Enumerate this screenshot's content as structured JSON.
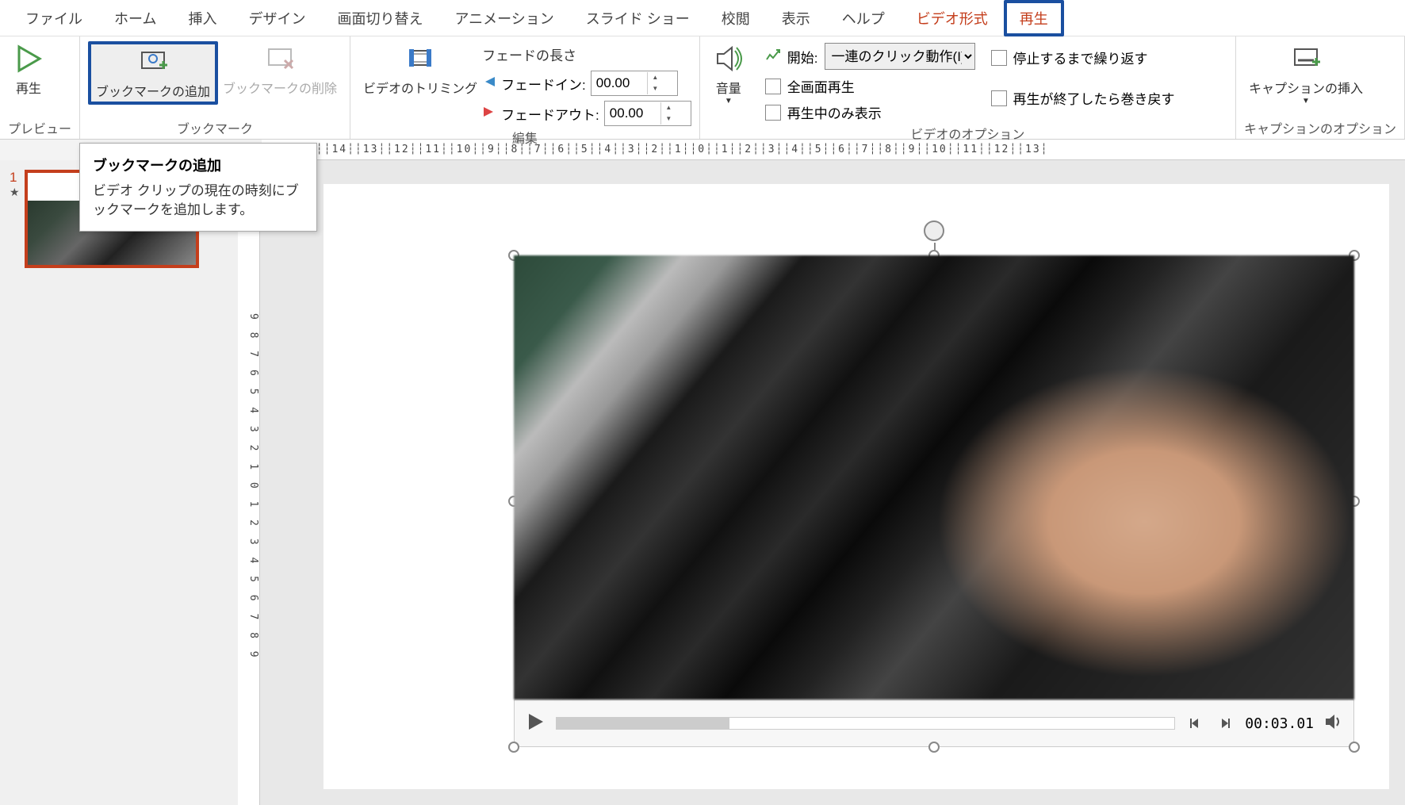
{
  "tabs": {
    "file": "ファイル",
    "home": "ホーム",
    "insert": "挿入",
    "design": "デザイン",
    "transition": "画面切り替え",
    "animation": "アニメーション",
    "slideshow": "スライド ショー",
    "review": "校閲",
    "view": "表示",
    "help": "ヘルプ",
    "video_format": "ビデオ形式",
    "playback": "再生"
  },
  "ribbon": {
    "preview": {
      "play": "再生",
      "group": "プレビュー"
    },
    "bookmark": {
      "add": "ブックマークの追加",
      "remove": "ブックマークの削除",
      "group": "ブックマーク"
    },
    "edit": {
      "trim": "ビデオのトリミング",
      "fade_len": "フェードの長さ",
      "fade_in": "フェードイン:",
      "fade_out": "フェードアウト:",
      "fade_in_val": "00.00",
      "fade_out_val": "00.00",
      "group": "編集"
    },
    "video_opts": {
      "volume": "音量",
      "start": "開始:",
      "start_val": "一連のクリック動作(I)",
      "fullscreen": "全画面再生",
      "hide": "再生中のみ表示",
      "loop": "停止するまで繰り返す",
      "rewind": "再生が終了したら巻き戻す",
      "group": "ビデオのオプション"
    },
    "caption": {
      "insert": "キャプションの挿入",
      "group": "キャプションのオプション"
    }
  },
  "tooltip": {
    "title": "ブックマークの追加",
    "body": "ビデオ クリップの現在の時刻にブックマークを追加します。"
  },
  "ruler": {
    "h": "┆16┆┆15┆┆14┆┆13┆┆12┆┆11┆┆10┆┆9┆┆8┆┆7┆┆6┆┆5┆┆4┆┆3┆┆2┆┆1┆┆0┆┆1┆┆2┆┆3┆┆4┆┆5┆┆6┆┆7┆┆8┆┆9┆┆10┆┆11┆┆12┆┆13┆",
    "v": "9 8 7 6 5 4 3 2 1 0 1 2 3 4 5 6 7 8 9"
  },
  "slidepanel": {
    "num": "1",
    "star": "★"
  },
  "player": {
    "time": "00:03.01"
  }
}
